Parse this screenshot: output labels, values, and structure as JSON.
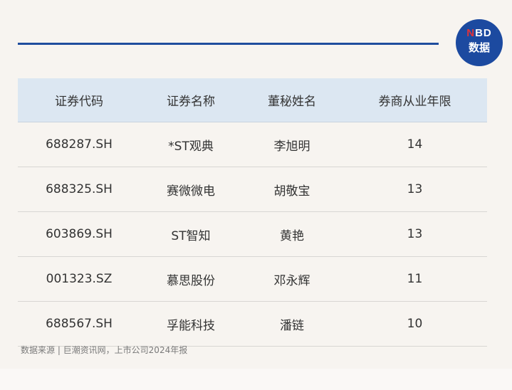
{
  "logo": {
    "line1_red": "N",
    "line1_rest": "BD",
    "line2": "数据"
  },
  "table": {
    "headers": [
      "证券代码",
      "证券名称",
      "董秘姓名",
      "券商从业年限"
    ],
    "rows": [
      [
        "688287.SH",
        "*ST观典",
        "李旭明",
        "14"
      ],
      [
        "688325.SH",
        "赛微微电",
        "胡敬宝",
        "13"
      ],
      [
        "603869.SH",
        "ST智知",
        "黄艳",
        "13"
      ],
      [
        "001323.SZ",
        "慕思股份",
        "邓永辉",
        "11"
      ],
      [
        "688567.SH",
        "孚能科技",
        "潘链",
        "10"
      ]
    ]
  },
  "source": "数据来源 | 巨潮资讯网，上市公司2024年报"
}
